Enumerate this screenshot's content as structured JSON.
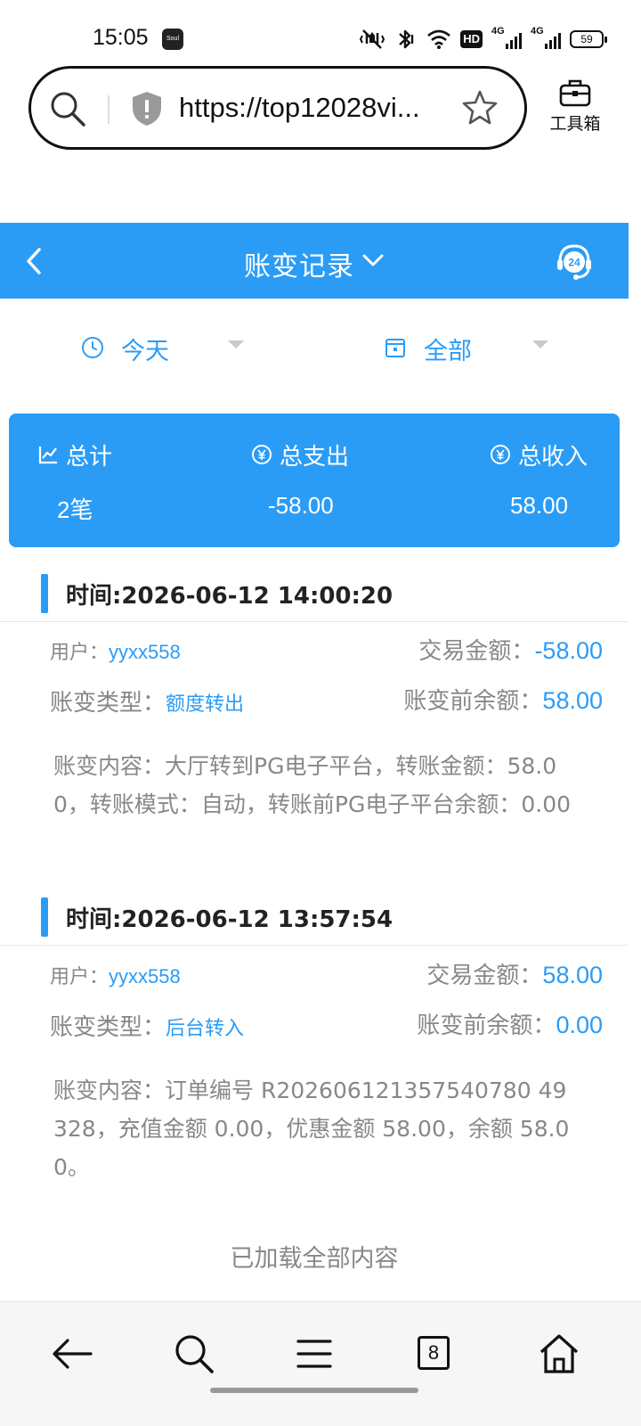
{
  "status_bar": {
    "time": "15:05",
    "app_badge": "Soul",
    "network_badge": "HD",
    "sim1_label": "4G",
    "sim2_label": "4G",
    "battery": "59"
  },
  "browser": {
    "url": "https://top12028vi...",
    "toolbox_label": "工具箱"
  },
  "header": {
    "title": "账变记录",
    "support_label": "24"
  },
  "filters": {
    "day": "今天",
    "type": "全部"
  },
  "summary": {
    "total_label": "总计",
    "total_value": "2笔",
    "expense_label": "总支出",
    "expense_value": "-58.00",
    "income_label": "总收入",
    "income_value": "58.00"
  },
  "labels": {
    "user": "用户：",
    "amount": "交易金额：",
    "type": "账变类型：",
    "before_balance": "账变前余额："
  },
  "records": [
    {
      "time": "时间:2026-06-12 14:00:20",
      "user": "yyxx558",
      "amount": "-58.00",
      "type": "额度转出",
      "before_balance": "58.00",
      "content": "账变内容：大厅转到PG电子平台，转账金额：58.00，转账模式：自动，转账前PG电子平台余额：0.00"
    },
    {
      "time": "时间:2026-06-12 13:57:54",
      "user": "yyxx558",
      "amount": "58.00",
      "type": "后台转入",
      "before_balance": "0.00",
      "content": "账变内容：订单编号 R202606121357540780 49328，充值金额 0.00，优惠金额 58.00，余额 58.00。"
    }
  ],
  "footer": {
    "loaded_all": "已加载全部内容"
  },
  "bottom_nav": {
    "tabs_count": "8"
  },
  "colors": {
    "accent": "#2b9cf6",
    "muted_text": "#888888"
  }
}
